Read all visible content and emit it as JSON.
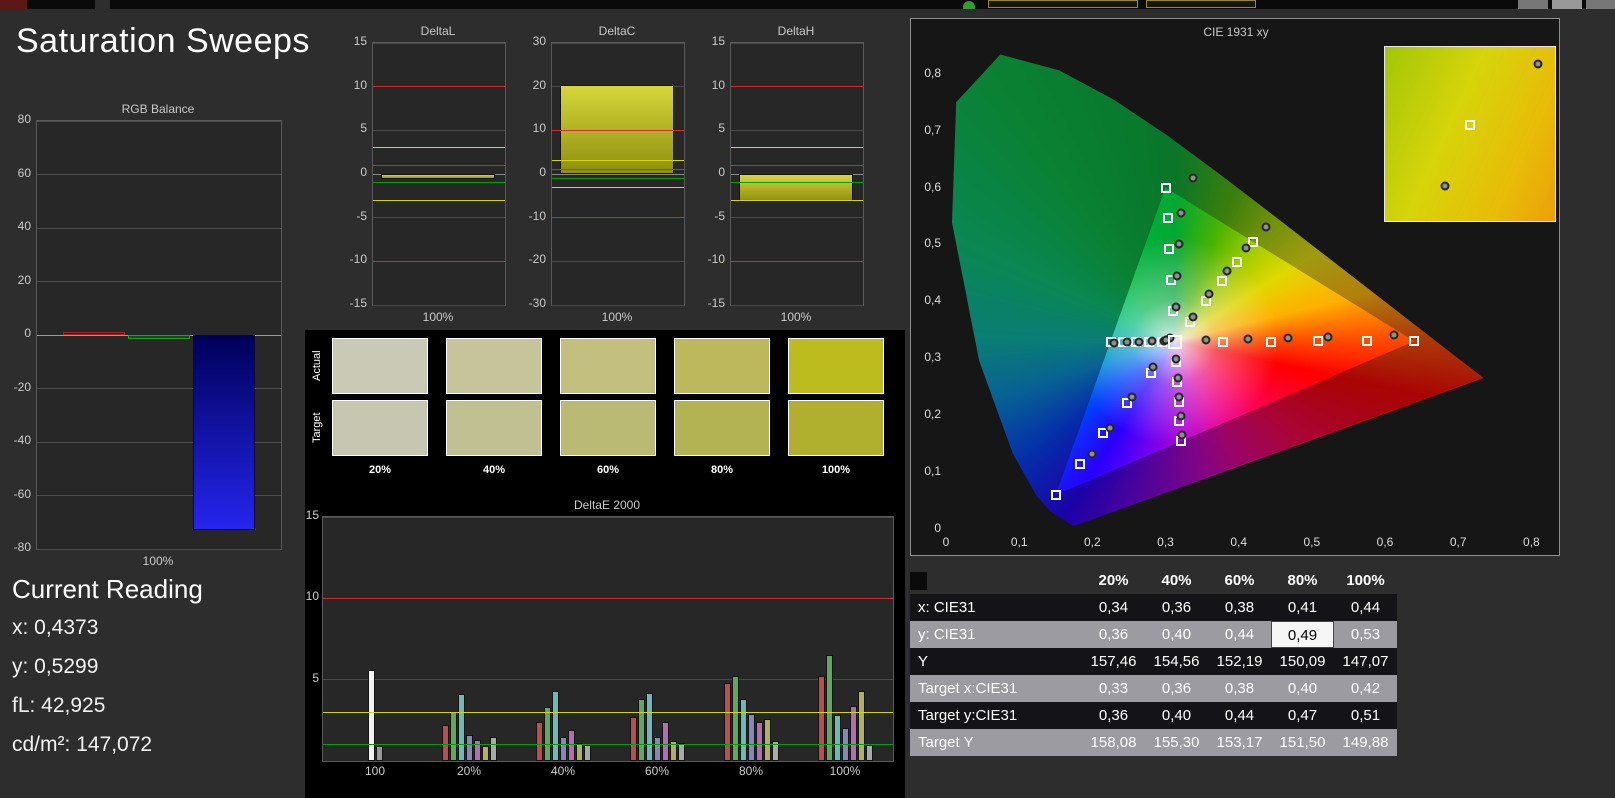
{
  "page": {
    "title": "Saturation Sweeps"
  },
  "rgb_balance": {
    "title": "RGB Balance",
    "xlabel": "100%",
    "ylim": [
      -80,
      80
    ],
    "yticks": [
      80,
      60,
      40,
      20,
      0,
      -20,
      -40,
      -60,
      -80
    ],
    "bars": [
      {
        "name": "red",
        "value": 1,
        "color": "#401010",
        "border": "#a02525"
      },
      {
        "name": "green",
        "value": -1.5,
        "color": "#0c4f10",
        "border": "#1f9f25"
      },
      {
        "name": "blue",
        "value": -73,
        "gradient": [
          "#00005a",
          "#2525ee"
        ],
        "border": "#0a0a30"
      }
    ]
  },
  "current_reading": {
    "title": "Current Reading",
    "lines": [
      "x: 0,4373",
      "y: 0,5299",
      "fL: 42,925",
      "cd/m²: 147,072"
    ]
  },
  "delta_charts": [
    {
      "title": "DeltaL",
      "xlabel": "100%",
      "ylim": [
        -15,
        15
      ],
      "yticks": [
        15,
        10,
        5,
        0,
        -5,
        -10,
        -15
      ],
      "value": -0.6,
      "limits": {
        "red": 10,
        "yellow": 3,
        "green": 1
      }
    },
    {
      "title": "DeltaC",
      "xlabel": "100%",
      "ylim": [
        -30,
        30
      ],
      "yticks": [
        30,
        20,
        10,
        0,
        -10,
        -20,
        -30
      ],
      "value": 20.4,
      "limits": {
        "red": 10,
        "yellow": 3,
        "green": 1
      }
    },
    {
      "title": "DeltaH",
      "xlabel": "100%",
      "ylim": [
        -15,
        15
      ],
      "yticks": [
        15,
        10,
        5,
        0,
        -5,
        -10,
        -15
      ],
      "value": -3.2,
      "limits": {
        "red": 10,
        "yellow": 3,
        "green": 1
      }
    }
  ],
  "swatches": {
    "row_labels": [
      "Actual",
      "Target"
    ],
    "col_labels": [
      "20%",
      "40%",
      "60%",
      "80%",
      "100%"
    ],
    "actual": [
      "#c9c9b6",
      "#c7c49c",
      "#c3bf7e",
      "#bdb85c",
      "#bdbc1e"
    ],
    "target": [
      "#c6c6b1",
      "#c1c093",
      "#bbba74",
      "#b4b353",
      "#b0af2e"
    ]
  },
  "chart_data": {
    "type": "bar",
    "title": "DeltaE 2000",
    "ylim": [
      0,
      15
    ],
    "yticks": [
      15,
      10,
      5
    ],
    "limits": {
      "red": 10,
      "yellow": 3,
      "green": 1
    },
    "groups": [
      {
        "label": "100",
        "bars": [
          {
            "color": "#f2f2f2",
            "value": 5.6
          },
          {
            "color": "#9a9a9a",
            "value": 0.9
          }
        ]
      },
      {
        "label": "20%",
        "bars": [
          {
            "color": "#b85050",
            "value": 2.2
          },
          {
            "color": "#60a860",
            "value": 3.0
          },
          {
            "color": "#70b8b8",
            "value": 4.1
          },
          {
            "color": "#8888b8",
            "value": 1.6
          },
          {
            "color": "#b070b0",
            "value": 1.3
          },
          {
            "color": "#b0b060",
            "value": 0.9
          },
          {
            "color": "#aaaaaa",
            "value": 1.5
          }
        ]
      },
      {
        "label": "40%",
        "bars": [
          {
            "color": "#b85050",
            "value": 2.4
          },
          {
            "color": "#60a860",
            "value": 3.3
          },
          {
            "color": "#70b8b8",
            "value": 4.3
          },
          {
            "color": "#8888b8",
            "value": 1.5
          },
          {
            "color": "#b070b0",
            "value": 1.9
          },
          {
            "color": "#b0b060",
            "value": 1.1
          },
          {
            "color": "#aaaaaa",
            "value": 1.0
          }
        ]
      },
      {
        "label": "60%",
        "bars": [
          {
            "color": "#b85050",
            "value": 2.7
          },
          {
            "color": "#60a860",
            "value": 3.8
          },
          {
            "color": "#70b8b8",
            "value": 4.2
          },
          {
            "color": "#8888b8",
            "value": 1.5
          },
          {
            "color": "#b070b0",
            "value": 2.4
          },
          {
            "color": "#b0b060",
            "value": 1.2
          },
          {
            "color": "#aaaaaa",
            "value": 1.1
          }
        ]
      },
      {
        "label": "80%",
        "bars": [
          {
            "color": "#b85050",
            "value": 4.8
          },
          {
            "color": "#60a860",
            "value": 5.2
          },
          {
            "color": "#70b8b8",
            "value": 3.8
          },
          {
            "color": "#8888b8",
            "value": 2.9
          },
          {
            "color": "#b070b0",
            "value": 2.4
          },
          {
            "color": "#b0b060",
            "value": 2.6
          },
          {
            "color": "#aaaaaa",
            "value": 1.2
          }
        ]
      },
      {
        "label": "100%",
        "bars": [
          {
            "color": "#b85050",
            "value": 5.2
          },
          {
            "color": "#60a860",
            "value": 6.5
          },
          {
            "color": "#70b8b8",
            "value": 2.8
          },
          {
            "color": "#8888b8",
            "value": 2.0
          },
          {
            "color": "#b070b0",
            "value": 3.4
          },
          {
            "color": "#b0b060",
            "value": 4.3
          },
          {
            "color": "#aaaaaa",
            "value": 1.0
          }
        ]
      }
    ]
  },
  "cie_chart": {
    "title": "CIE 1931 xy",
    "xticks": [
      "0",
      "0,1",
      "0,2",
      "0,3",
      "0,4",
      "0,5",
      "0,6",
      "0,7",
      "0,8"
    ],
    "yticks": [
      "0",
      "0,1",
      "0,2",
      "0,3",
      "0,4",
      "0,5",
      "0,6",
      "0,7",
      "0,8"
    ],
    "white_point": [
      0.3127,
      0.329
    ],
    "gamut_triangle": [
      [
        0.64,
        0.33
      ],
      [
        0.3,
        0.6
      ],
      [
        0.15,
        0.06
      ]
    ],
    "targets": [
      [
        0.378,
        0.329
      ],
      [
        0.444,
        0.329
      ],
      [
        0.509,
        0.33
      ],
      [
        0.575,
        0.33
      ],
      [
        0.64,
        0.33
      ],
      [
        0.31,
        0.383
      ],
      [
        0.308,
        0.437
      ],
      [
        0.305,
        0.492
      ],
      [
        0.303,
        0.546
      ],
      [
        0.3,
        0.6
      ],
      [
        0.28,
        0.275
      ],
      [
        0.248,
        0.221
      ],
      [
        0.215,
        0.168
      ],
      [
        0.183,
        0.114
      ],
      [
        0.15,
        0.06
      ],
      [
        0.295,
        0.329
      ],
      [
        0.277,
        0.329
      ],
      [
        0.26,
        0.329
      ],
      [
        0.242,
        0.329
      ],
      [
        0.225,
        0.329
      ],
      [
        0.314,
        0.294
      ],
      [
        0.316,
        0.259
      ],
      [
        0.318,
        0.224
      ],
      [
        0.319,
        0.189
      ],
      [
        0.321,
        0.154
      ],
      [
        0.334,
        0.364
      ],
      [
        0.355,
        0.4
      ],
      [
        0.377,
        0.435
      ],
      [
        0.398,
        0.47
      ],
      [
        0.419,
        0.505
      ]
    ],
    "measurements": [
      [
        0.355,
        0.332
      ],
      [
        0.413,
        0.334
      ],
      [
        0.468,
        0.336
      ],
      [
        0.522,
        0.338
      ],
      [
        0.612,
        0.341
      ],
      [
        0.314,
        0.39
      ],
      [
        0.316,
        0.445
      ],
      [
        0.318,
        0.5
      ],
      [
        0.321,
        0.555
      ],
      [
        0.337,
        0.616
      ],
      [
        0.283,
        0.284
      ],
      [
        0.254,
        0.232
      ],
      [
        0.224,
        0.178
      ],
      [
        0.199,
        0.132
      ],
      [
        0.298,
        0.331
      ],
      [
        0.281,
        0.33
      ],
      [
        0.264,
        0.329
      ],
      [
        0.247,
        0.328
      ],
      [
        0.23,
        0.327
      ],
      [
        0.315,
        0.298
      ],
      [
        0.317,
        0.265
      ],
      [
        0.319,
        0.232
      ],
      [
        0.321,
        0.198
      ],
      [
        0.323,
        0.165
      ],
      [
        0.337,
        0.372
      ],
      [
        0.36,
        0.413
      ],
      [
        0.384,
        0.454
      ],
      [
        0.41,
        0.493
      ],
      [
        0.437,
        0.53
      ],
      [
        0.306,
        0.335
      ],
      [
        0.3,
        0.332
      ]
    ],
    "inset": {
      "square": [
        50,
        45
      ],
      "dots": [
        [
          35,
          80
        ],
        [
          90,
          10
        ]
      ]
    }
  },
  "table": {
    "columns": [
      "20%",
      "40%",
      "60%",
      "80%",
      "100%"
    ],
    "rows": [
      {
        "label": "x: CIE31",
        "values": [
          "0,34",
          "0,36",
          "0,38",
          "0,41",
          "0,44"
        ]
      },
      {
        "label": "y: CIE31",
        "values": [
          "0,36",
          "0,40",
          "0,44",
          "0,49",
          "0,53"
        ]
      },
      {
        "label": "Y",
        "values": [
          "157,46",
          "154,56",
          "152,19",
          "150,09",
          "147,07"
        ]
      },
      {
        "label": "Target x:CIE31",
        "values": [
          "0,33",
          "0,36",
          "0,38",
          "0,40",
          "0,42"
        ]
      },
      {
        "label": "Target y:CIE31",
        "values": [
          "0,36",
          "0,40",
          "0,44",
          "0,47",
          "0,51"
        ]
      },
      {
        "label": "Target Y",
        "values": [
          "158,08",
          "155,30",
          "153,17",
          "151,50",
          "149,88"
        ]
      }
    ],
    "selected_cell": {
      "row": 1,
      "col": 3
    }
  }
}
